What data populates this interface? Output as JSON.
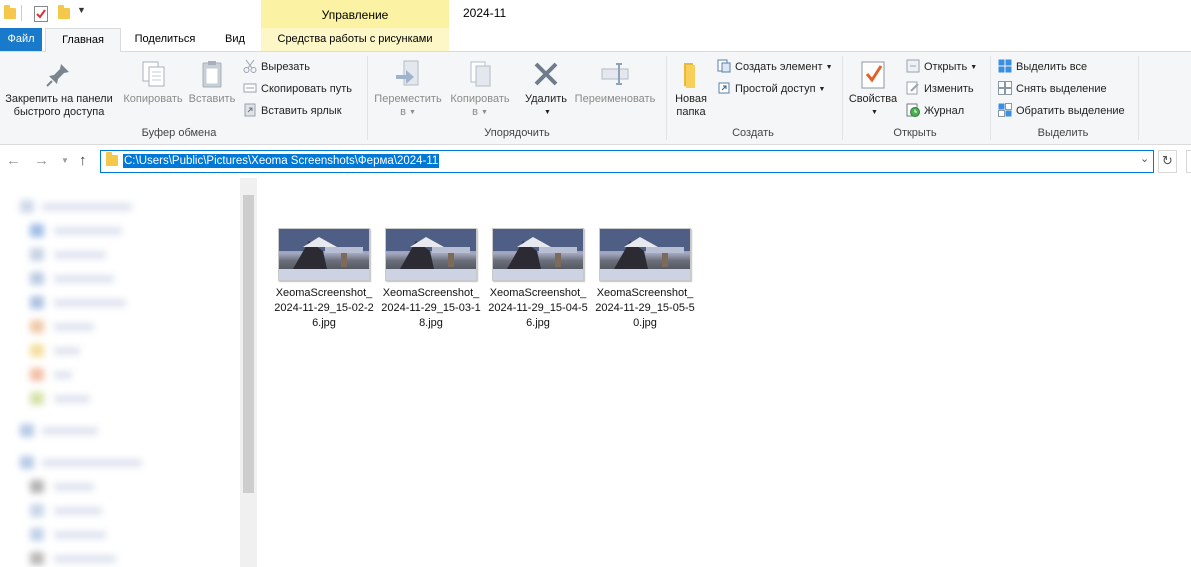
{
  "titlebar": {
    "context_tab": "Управление",
    "window_title": "2024-11"
  },
  "tabs": {
    "file": "Файл",
    "home": "Главная",
    "share": "Поделиться",
    "view": "Вид",
    "picture_tools": "Средства работы с рисунками"
  },
  "ribbon": {
    "clipboard": {
      "label": "Буфер обмена",
      "pin": [
        "Закрепить на панели",
        "быстрого доступа"
      ],
      "copy": "Копировать",
      "paste": "Вставить",
      "cut": "Вырезать",
      "copy_path": "Скопировать путь",
      "paste_shortcut": "Вставить ярлык"
    },
    "organize": {
      "label": "Упорядочить",
      "move_to": [
        "Переместить",
        "в"
      ],
      "copy_to": [
        "Копировать",
        "в"
      ],
      "delete": "Удалить",
      "rename": "Переименовать"
    },
    "new": {
      "label": "Создать",
      "new_folder": [
        "Новая",
        "папка"
      ],
      "new_item": "Создать элемент",
      "easy_access": "Простой доступ"
    },
    "open": {
      "label": "Открыть",
      "properties": "Свойства",
      "open": "Открыть",
      "edit": "Изменить",
      "history": "Журнал"
    },
    "select": {
      "label": "Выделить",
      "select_all": "Выделить все",
      "select_none": "Снять выделение",
      "invert": "Обратить выделение"
    }
  },
  "address": {
    "path": "C:\\Users\\Public\\Pictures\\Xeoma Screenshots\\Ферма\\2024-11"
  },
  "files": [
    {
      "name": "XeomaScreenshot_2024-11-29_15-02-26.jpg"
    },
    {
      "name": "XeomaScreenshot_2024-11-29_15-03-18.jpg"
    },
    {
      "name": "XeomaScreenshot_2024-11-29_15-04-56.jpg"
    },
    {
      "name": "XeomaScreenshot_2024-11-29_15-05-50.jpg"
    }
  ],
  "colors": {
    "accent": "#1979ca",
    "context_tab": "#fbf3a3",
    "selection": "#0078d7"
  }
}
